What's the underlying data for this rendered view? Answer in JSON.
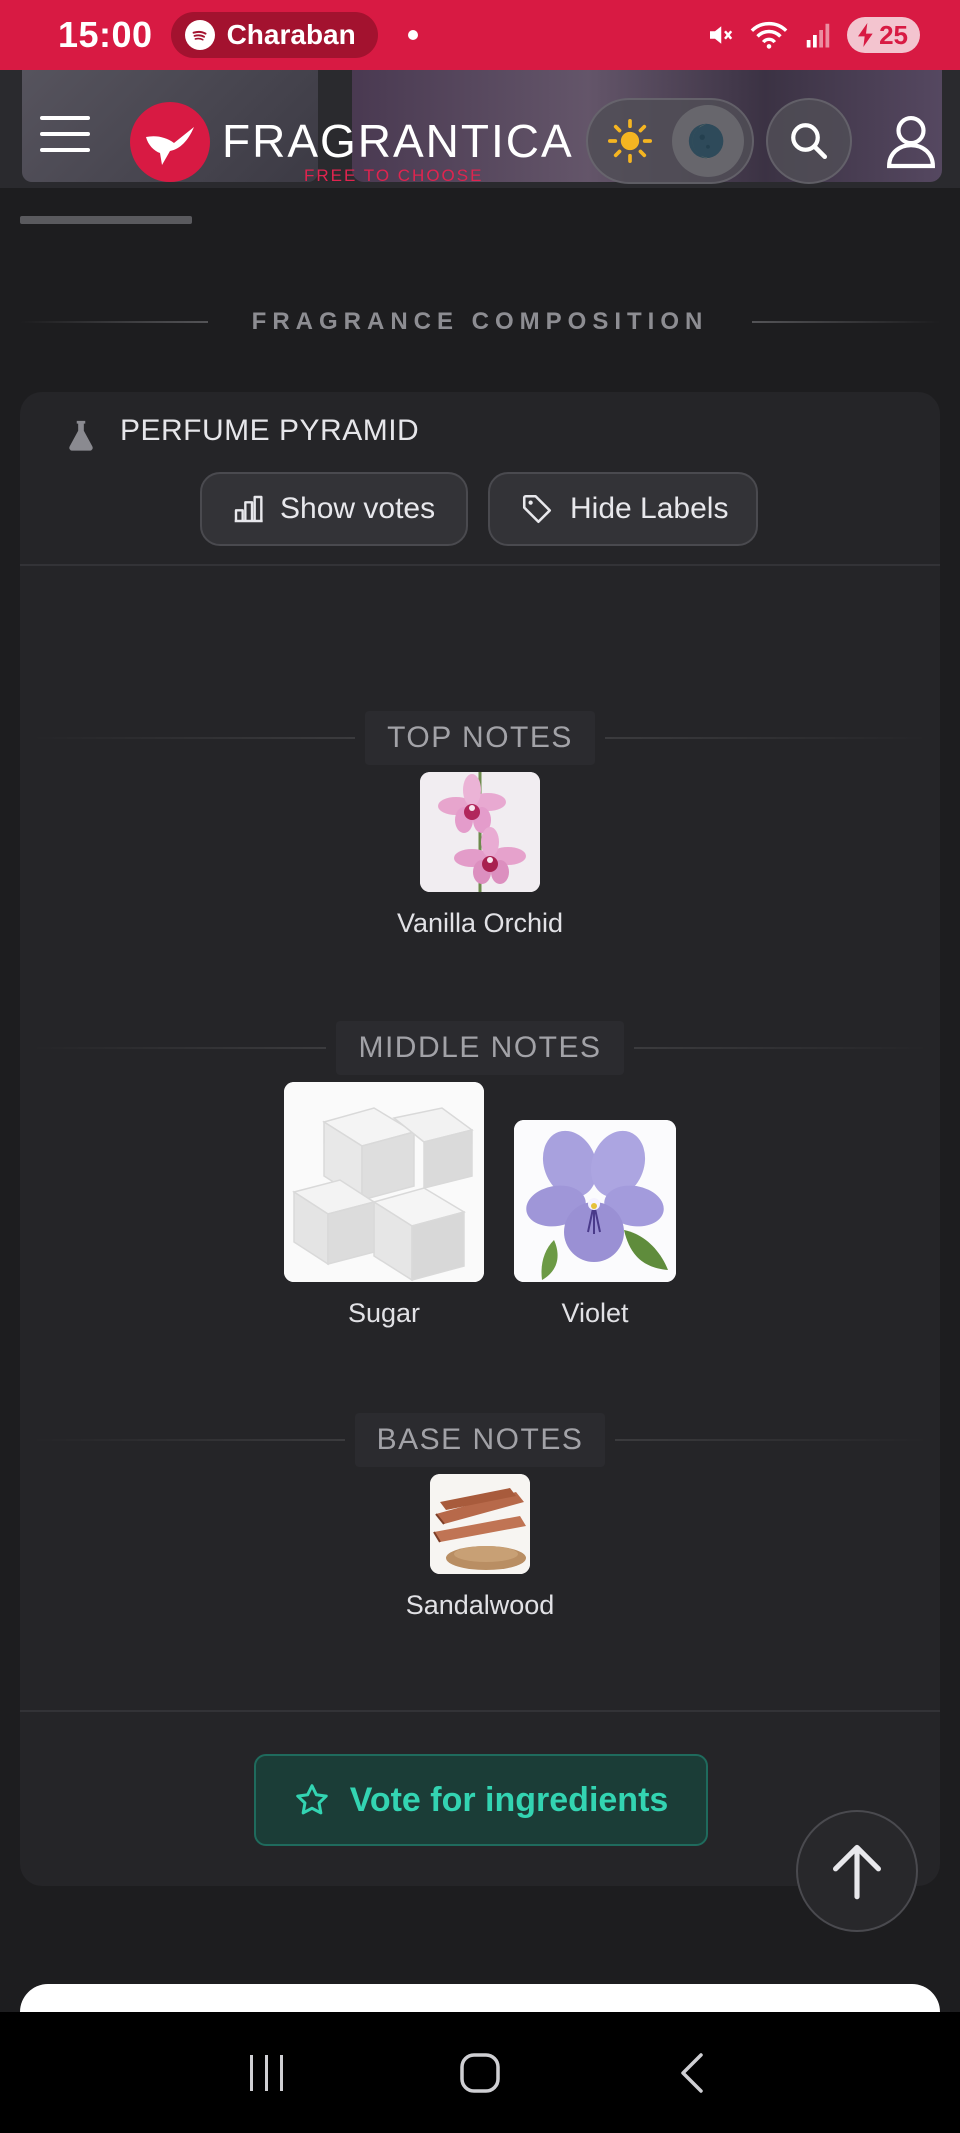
{
  "status_bar": {
    "time": "15:00",
    "media_app": "Charaban",
    "battery": "25"
  },
  "header": {
    "logo_text": "FRAGRANTICA",
    "tagline": "FREE TO CHOOSE",
    "icons": [
      "menu-icon",
      "logo-bird-icon",
      "sun-icon",
      "moon-icon",
      "search-icon",
      "user-icon"
    ]
  },
  "section": {
    "title": "FRAGRANCE COMPOSITION"
  },
  "pyramid": {
    "title": "PERFUME PYRAMID",
    "show_votes_label": "Show votes",
    "hide_labels_label": "Hide Labels",
    "top": {
      "label": "TOP NOTES",
      "notes": [
        {
          "name": "Vanilla Orchid",
          "image": "orchid"
        }
      ]
    },
    "middle": {
      "label": "MIDDLE NOTES",
      "notes": [
        {
          "name": "Sugar",
          "image": "sugar-cubes"
        },
        {
          "name": "Violet",
          "image": "violet-flower"
        }
      ]
    },
    "base": {
      "label": "BASE NOTES",
      "notes": [
        {
          "name": "Sandalwood",
          "image": "sandalwood-sticks"
        }
      ]
    },
    "vote_label": "Vote for ingredients"
  },
  "colors": {
    "brand_red": "#d81a43",
    "accent_teal": "#33d4b2",
    "background": "#1d1d1f",
    "card": "#252528"
  }
}
